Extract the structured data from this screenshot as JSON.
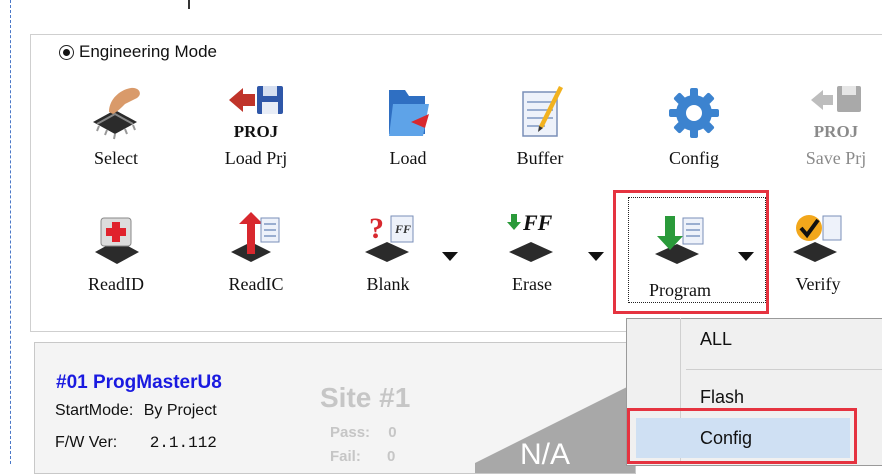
{
  "mode": {
    "label": "Engineering Mode",
    "selected": true
  },
  "toolbar_row1": [
    {
      "label": "Select",
      "icon": "hand-chip-icon",
      "enabled": true
    },
    {
      "label": "Load Prj",
      "icon": "load-project-icon",
      "icon_text": "PROJ",
      "enabled": true
    },
    {
      "label": "Load",
      "icon": "folder-open-icon",
      "enabled": true
    },
    {
      "label": "Buffer",
      "icon": "buffer-edit-icon",
      "enabled": true
    },
    {
      "label": "Config",
      "icon": "gear-icon",
      "enabled": true
    },
    {
      "label": "Save Prj",
      "icon": "save-project-icon",
      "icon_text": "PROJ",
      "enabled": false
    }
  ],
  "toolbar_row2": [
    {
      "label": "ReadID",
      "icon": "read-id-icon"
    },
    {
      "label": "ReadIC",
      "icon": "read-ic-icon"
    },
    {
      "label": "Blank",
      "icon": "blank-check-icon",
      "icon_text": "?",
      "icon_sub": "FF"
    },
    {
      "label": "Erase",
      "icon": "erase-icon",
      "icon_text": "FF"
    },
    {
      "label": "Program",
      "icon": "program-icon"
    },
    {
      "label": "Verify",
      "icon": "verify-icon"
    }
  ],
  "site": {
    "title": "#01 ProgMasterU8",
    "start_mode_label": "StartMode:",
    "start_mode_value": "By Project",
    "fw_label": "F/W Ver:",
    "fw_value": "2.1.112",
    "site_label": "Site #1",
    "pass_label": "Pass:",
    "pass_value": "0",
    "fail_label": "Fail:",
    "fail_value": "0",
    "status": "N/A"
  },
  "program_menu": {
    "items": [
      "ALL",
      "Flash",
      "Config"
    ],
    "highlighted": "Config"
  },
  "colors": {
    "highlight_box": "#e53340",
    "site_title": "#1a1ae0",
    "menu_highlight": "#cfe0f3"
  }
}
